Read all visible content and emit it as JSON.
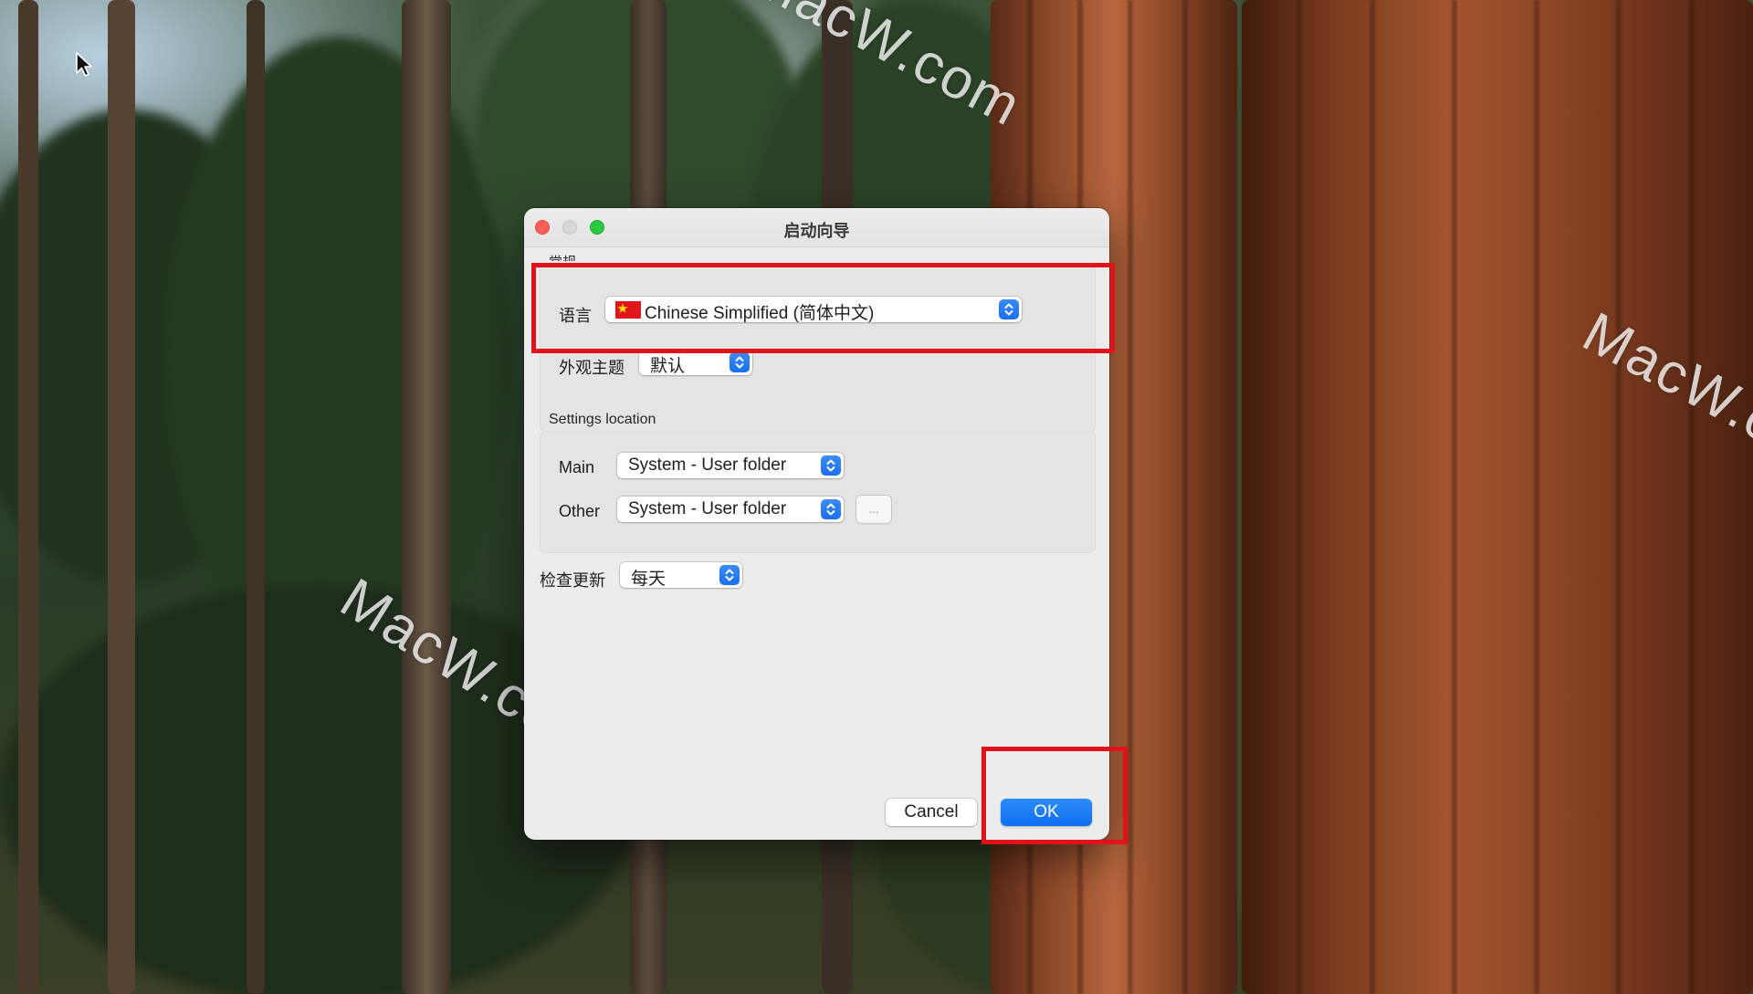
{
  "desktop": {
    "watermark_text": "MacW.com",
    "accent_highlight_color": "#e0121a"
  },
  "window": {
    "title": "启动向导",
    "controls": {
      "close_color": "#ff5f57",
      "minimize_color": "#d6d6d6",
      "zoom_color": "#28c840"
    }
  },
  "general": {
    "group_label": "常规",
    "language_label": "语言",
    "language_value": "Chinese Simplified (简体中文)",
    "language_flag": "china-flag-icon",
    "theme_label": "外观主题",
    "theme_value": "默认"
  },
  "settings_location": {
    "group_label": "Settings location",
    "main_label": "Main",
    "main_value": "System - User folder",
    "other_label": "Other",
    "other_value": "System - User folder",
    "browse_label": "..."
  },
  "updates": {
    "label": "检查更新",
    "value": "每天"
  },
  "footer": {
    "cancel_label": "Cancel",
    "ok_label": "OK",
    "ok_color": "#1a73f0"
  }
}
